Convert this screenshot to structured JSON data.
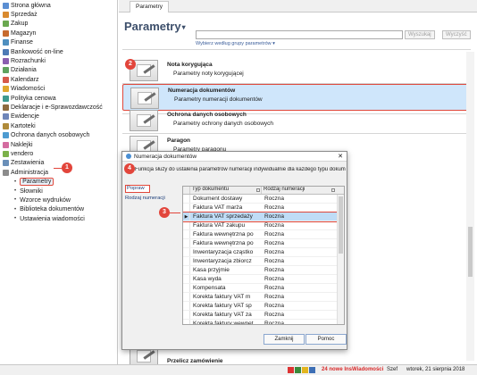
{
  "sidebar": {
    "items": [
      {
        "label": "Strona główna",
        "icon": "home-icon",
        "color": "#5b8fd3"
      },
      {
        "label": "Sprzedaż",
        "icon": "sales-icon",
        "color": "#d98a2f"
      },
      {
        "label": "Zakup",
        "icon": "purchase-icon",
        "color": "#6aa84f"
      },
      {
        "label": "Magazyn",
        "icon": "warehouse-icon",
        "color": "#c76b2e"
      },
      {
        "label": "Finanse",
        "icon": "finance-icon",
        "color": "#4f8fbf"
      },
      {
        "label": "Bankowość on-line",
        "icon": "bank-icon",
        "color": "#4d7ab5"
      },
      {
        "label": "Rozrachunki",
        "icon": "settlements-icon",
        "color": "#8a5fb0"
      },
      {
        "label": "Działania",
        "icon": "actions-icon",
        "color": "#5fa35f"
      },
      {
        "label": "Kalendarz",
        "icon": "calendar-icon",
        "color": "#d65a4a"
      },
      {
        "label": "Wiadomości",
        "icon": "messages-icon",
        "color": "#e0a82e"
      },
      {
        "label": "Polityka cenowa",
        "icon": "pricing-icon",
        "color": "#3f9a8f"
      },
      {
        "label": "Deklaracje i e-Sprawozdawczość",
        "icon": "declarations-icon",
        "color": "#8f6b3f"
      },
      {
        "label": "Ewidencje",
        "icon": "records-icon",
        "color": "#6f86b9"
      },
      {
        "label": "Kartoteki",
        "icon": "files-icon",
        "color": "#b08b3a"
      },
      {
        "label": "Ochrona danych osobowych",
        "icon": "privacy-icon",
        "color": "#4d9bd1"
      },
      {
        "label": "Naklejki",
        "icon": "stickers-icon",
        "color": "#d46ca0"
      },
      {
        "label": "vendero",
        "icon": "vendero-icon",
        "color": "#7bb14a"
      },
      {
        "label": "Zestawienia",
        "icon": "reports-icon",
        "color": "#6a8fb8"
      },
      {
        "label": "Administracja",
        "icon": "admin-icon",
        "color": "#8c8c8c"
      }
    ],
    "sub_items": [
      {
        "label": "Parametry",
        "active": true
      },
      {
        "label": "Słowniki",
        "active": false
      },
      {
        "label": "Wzorce wydruków",
        "active": false
      },
      {
        "label": "Biblioteka dokumentów",
        "active": false
      },
      {
        "label": "Ustawienia wiadomości",
        "active": false
      }
    ]
  },
  "tabs": [
    {
      "label": "Parametry"
    }
  ],
  "header": {
    "title": "Parametry",
    "search_placeholder": "",
    "search_button": "Wyszukaj",
    "clear_button": "Wyczyść",
    "filter_link": "Wybierz według grupy parametrów ▾"
  },
  "entries": [
    {
      "title": "Nota korygująca",
      "description": "Parametry noty korygującej",
      "selected": false
    },
    {
      "title": "Numeracja dokumentów",
      "description": "Parametry numeracji dokumentów",
      "selected": true
    },
    {
      "title": "Ochrona danych osobowych",
      "description": "Parametry ochrony danych osobowych",
      "selected": false
    },
    {
      "title": "Paragon",
      "description": "Parametry paragonu",
      "selected": false
    },
    {
      "title": "Przelicz zamówienie",
      "description": "",
      "selected": false
    }
  ],
  "modal": {
    "title": "Numeracja dokumentów",
    "description": "Funkcja służy do ustalenia parametrów numeracji indywidualnie dla każdego typu dokumentu.",
    "left_links": [
      {
        "label": "Popraw",
        "active": true
      },
      {
        "label": "Rodzaj numeracji",
        "active": false
      }
    ],
    "columns": [
      "Typ dokumentu",
      "Rodzaj numeracji"
    ],
    "rows": [
      {
        "type": "Dokument dostawy",
        "numbering": "Roczna",
        "selected": false
      },
      {
        "type": "Faktura VAT marża",
        "numbering": "Roczna",
        "selected": false
      },
      {
        "type": "Faktura VAT sprzedaży",
        "numbering": "Roczna",
        "selected": true
      },
      {
        "type": "Faktura VAT zakupu",
        "numbering": "Roczna",
        "selected": false
      },
      {
        "type": "Faktura wewnętrzna po",
        "numbering": "Roczna",
        "selected": false
      },
      {
        "type": "Faktura wewnętrzna po",
        "numbering": "Roczna",
        "selected": false
      },
      {
        "type": "Inwentaryzacja cząstko",
        "numbering": "Roczna",
        "selected": false
      },
      {
        "type": "Inwentaryzacja zbiorcz",
        "numbering": "Roczna",
        "selected": false
      },
      {
        "type": "Kasa przyjmie",
        "numbering": "Roczna",
        "selected": false
      },
      {
        "type": "Kasa wyda",
        "numbering": "Roczna",
        "selected": false
      },
      {
        "type": "Kompensata",
        "numbering": "Roczna",
        "selected": false
      },
      {
        "type": "Korekta faktury VAT m",
        "numbering": "Roczna",
        "selected": false
      },
      {
        "type": "Korekta faktury VAT sp",
        "numbering": "Roczna",
        "selected": false
      },
      {
        "type": "Korekta faktury VAT za",
        "numbering": "Roczna",
        "selected": false
      },
      {
        "type": "Korekta faktury wewnęt",
        "numbering": "Roczna",
        "selected": false
      }
    ],
    "close_button": "Zamknij",
    "help_button": "Pomoc"
  },
  "steps": [
    "1",
    "2",
    "3",
    "4"
  ],
  "statusbar": {
    "notifications": "24 nowe InsWiadomości",
    "user": "Szef",
    "date": "wtorek, 21 sierpnia 2018"
  },
  "colors": {
    "accent_red": "#e2453b",
    "selection_blue": "#cfe6fb",
    "title_blue": "#3d4f6b"
  }
}
